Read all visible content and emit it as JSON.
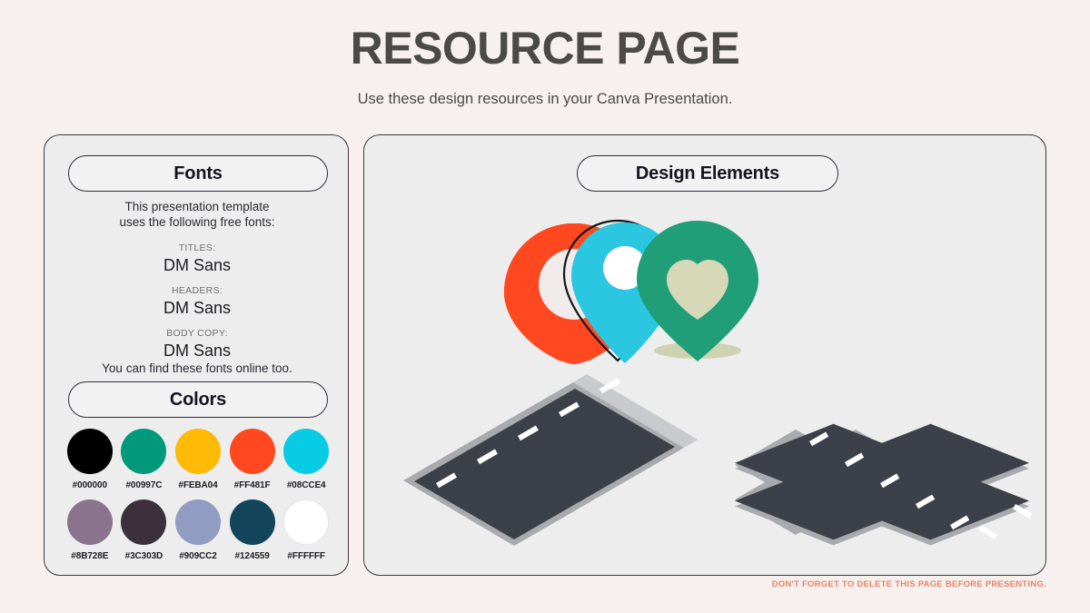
{
  "header": {
    "title": "RESOURCE PAGE",
    "subtitle": "Use these design resources in your Canva Presentation."
  },
  "fonts_panel": {
    "heading": "Fonts",
    "intro_line_1": "This presentation template",
    "intro_line_2": "uses the following free fonts:",
    "groups": [
      {
        "kind": "TITLES:",
        "name": "DM Sans"
      },
      {
        "kind": "HEADERS:",
        "name": "DM Sans"
      },
      {
        "kind": "BODY COPY:",
        "name": "DM Sans"
      }
    ],
    "outro": "You can find these fonts online too."
  },
  "colors_panel": {
    "heading": "Colors",
    "swatches": [
      {
        "hex": "#000000",
        "label": "#000000"
      },
      {
        "hex": "#00997C",
        "label": "#00997C"
      },
      {
        "hex": "#FEBA04",
        "label": "#FEBA04"
      },
      {
        "hex": "#FF481F",
        "label": "#FF481F"
      },
      {
        "hex": "#08CCE4",
        "label": "#08CCE4"
      },
      {
        "hex": "#8B728E",
        "label": "#8B728E"
      },
      {
        "hex": "#3C303D",
        "label": "#3C303D"
      },
      {
        "hex": "#909CC2",
        "label": "#909CC2"
      },
      {
        "hex": "#124559",
        "label": "#124559"
      },
      {
        "hex": "#FFFFFF",
        "label": "#FFFFFF"
      }
    ]
  },
  "design_panel": {
    "heading": "Design Elements",
    "elements": [
      {
        "name": "map-pin-circle",
        "color": "#FF481F",
        "inner": "#F4EFEC"
      },
      {
        "name": "map-pin-outlined",
        "color": "#2BC6E0",
        "outline": "#15151a",
        "inner": "#FFFFFF"
      },
      {
        "name": "map-pin-heart",
        "color": "#1F9E78",
        "inner": "#D6D8B8",
        "shadow": "#C9CCA4"
      },
      {
        "name": "isometric-road-straight",
        "surface": "#3C4049",
        "curb": "#A9AAAE",
        "dash": "#FFFFFF"
      },
      {
        "name": "isometric-road-intersection",
        "surface": "#3C4049",
        "curb": "#A9AAAE",
        "dash": "#FFFFFF"
      }
    ]
  },
  "footer": {
    "note": "DON'T FORGET TO DELETE THIS PAGE BEFORE PRESENTING.",
    "note_color": "#E8836A"
  }
}
